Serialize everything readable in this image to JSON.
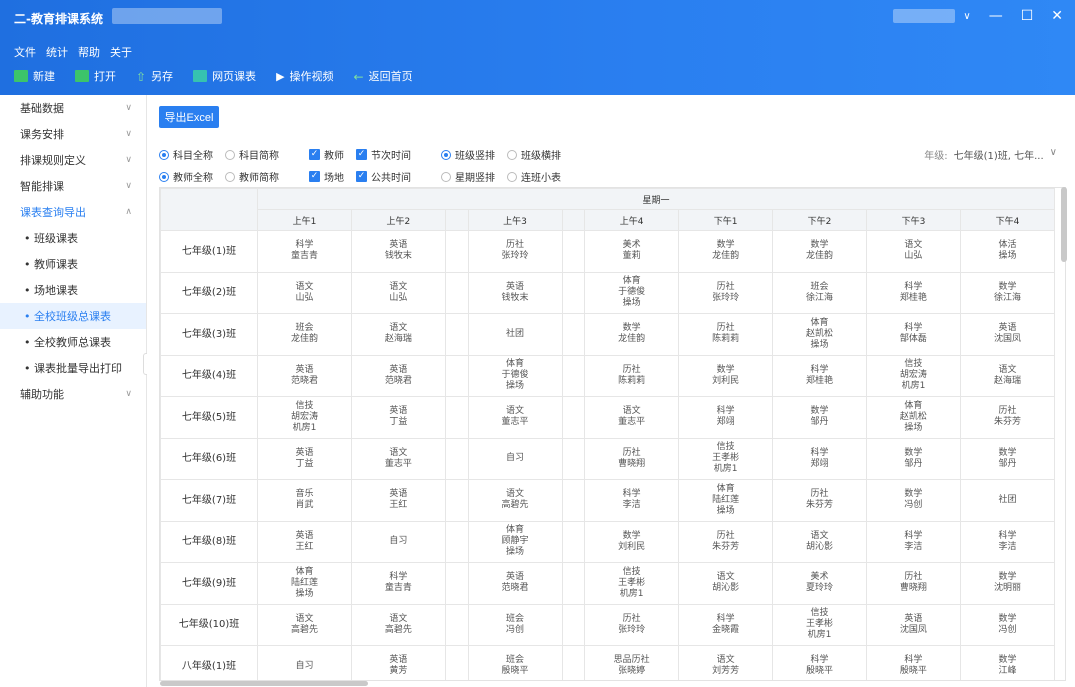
{
  "window": {
    "title": "二-教育排课系统"
  },
  "menu": [
    "文件",
    "统计",
    "帮助",
    "关于"
  ],
  "toolbar": [
    {
      "label": "新建",
      "icon": "new-file-icon"
    },
    {
      "label": "打开",
      "icon": "folder-icon"
    },
    {
      "label": "另存",
      "icon": "save-as-icon"
    },
    {
      "label": "网页课表",
      "icon": "web-table-icon"
    },
    {
      "label": "操作视频",
      "icon": "video-icon"
    },
    {
      "label": "返回首页",
      "icon": "back-arrow-icon"
    }
  ],
  "sidebar": {
    "items": [
      {
        "label": "基础数据",
        "chev": "∨"
      },
      {
        "label": "课务安排",
        "chev": "∨"
      },
      {
        "label": "排课规则定义",
        "chev": "∨"
      },
      {
        "label": "智能排课",
        "chev": "∨"
      },
      {
        "label": "课表查询导出",
        "chev": "∧"
      }
    ],
    "subitems": [
      "• 班级课表",
      "• 教师课表",
      "• 场地课表",
      "• 全校班级总课表",
      "• 全校教师总课表",
      "• 课表批量导出打印"
    ],
    "active_sub": 3,
    "last": {
      "label": "辅助功能",
      "chev": "∨"
    }
  },
  "export_label": "导出Excel",
  "options": {
    "row1": {
      "radios1": [
        {
          "label": "科目全称",
          "on": true
        },
        {
          "label": "科目简称",
          "on": false
        }
      ],
      "checks": [
        {
          "label": "教师",
          "on": true
        },
        {
          "label": "节次时间",
          "on": true
        }
      ],
      "radios2": [
        {
          "label": "班级竖排",
          "on": true
        },
        {
          "label": "班级横排",
          "on": false
        }
      ]
    },
    "row2": {
      "radios1": [
        {
          "label": "教师全称",
          "on": true
        },
        {
          "label": "教师简称",
          "on": false
        }
      ],
      "checks": [
        {
          "label": "场地",
          "on": true
        },
        {
          "label": "公共时间",
          "on": true
        }
      ],
      "radios2": [
        {
          "label": "星期竖排",
          "on": false
        },
        {
          "label": "连班小表",
          "on": false
        }
      ]
    }
  },
  "grade": {
    "label": "年级:",
    "value": "七年级(1)班, 七年..."
  },
  "table": {
    "day": "星期一",
    "periods": [
      "上午1",
      "上午2",
      "",
      "上午3",
      "",
      "上午4",
      "下午1",
      "下午2",
      "下午3",
      "下午4"
    ],
    "rows": [
      {
        "cls": "七年级(1)班",
        "cells": [
          "科学\n童吉青",
          "英语\n钱牧末",
          "",
          "历社\n张玲玲",
          "",
          "美术\n董莉",
          "数学\n龙佳韵",
          "数学\n龙佳韵",
          "语文\n山弘",
          "体活\n操场"
        ]
      },
      {
        "cls": "七年级(2)班",
        "cells": [
          "语文\n山弘",
          "语文\n山弘",
          "",
          "英语\n钱牧末",
          "",
          "体育\n于德俊\n操场",
          "历社\n张玲玲",
          "班会\n徐江海",
          "科学\n郑桂艳",
          "数学\n徐江海"
        ]
      },
      {
        "cls": "七年级(3)班",
        "cells": [
          "班会\n龙佳韵",
          "语文\n赵海瑞",
          "",
          "社团",
          "",
          "数学\n龙佳韵",
          "历社\n陈莉莉",
          "体育\n赵凯松\n操场",
          "科学\n郜体磊",
          "英语\n沈国凤"
        ]
      },
      {
        "cls": "七年级(4)班",
        "cells": [
          "英语\n范晓君",
          "英语\n范晓君",
          "",
          "体育\n于德俊\n操场",
          "",
          "历社\n陈莉莉",
          "数学\n刘利民",
          "科学\n郑桂艳",
          "信技\n胡宏涛\n机房1",
          "语文\n赵海瑞"
        ]
      },
      {
        "cls": "七年级(5)班",
        "cells": [
          "信技\n胡宏涛\n机房1",
          "英语\n丁益",
          "",
          "语文\n董志平",
          "",
          "语文\n董志平",
          "科学\n郑翊",
          "数学\n邹丹",
          "体育\n赵凯松\n操场",
          "历社\n朱芬芳"
        ]
      },
      {
        "cls": "七年级(6)班",
        "cells": [
          "英语\n丁益",
          "语文\n董志平",
          "",
          "自习",
          "",
          "历社\n曹晓翔",
          "信技\n王孝彬\n机房1",
          "科学\n郑翊",
          "数学\n邹丹",
          "数学\n邹丹"
        ]
      },
      {
        "cls": "七年级(7)班",
        "cells": [
          "音乐\n肖武",
          "英语\n王红",
          "",
          "语文\n高碧先",
          "",
          "科学\n李洁",
          "体育\n陆红莲\n操场",
          "历社\n朱芬芳",
          "数学\n冯创",
          "社团"
        ]
      },
      {
        "cls": "七年级(8)班",
        "cells": [
          "英语\n王红",
          "自习",
          "",
          "体育\n顾静宇\n操场",
          "",
          "数学\n刘利民",
          "历社\n朱芬芳",
          "语文\n胡沁影",
          "科学\n李洁",
          "科学\n李洁"
        ]
      },
      {
        "cls": "七年级(9)班",
        "cells": [
          "体育\n陆红莲\n操场",
          "科学\n童吉青",
          "",
          "英语\n范晓君",
          "",
          "信技\n王孝彬\n机房1",
          "语文\n胡沁影",
          "美术\n夏玲玲",
          "历社\n曹晓翔",
          "数学\n沈明丽"
        ]
      },
      {
        "cls": "七年级(10)班",
        "cells": [
          "语文\n高碧先",
          "语文\n高碧先",
          "",
          "班会\n冯创",
          "",
          "历社\n张玲玲",
          "科学\n金晓霞",
          "信技\n王孝彬\n机房1",
          "英语\n沈国凤",
          "数学\n冯创"
        ]
      },
      {
        "cls": "八年级(1)班",
        "cells": [
          "自习",
          "英语\n黄芳",
          "",
          "班会\n殷晓平",
          "",
          "思品历社\n张晓婷",
          "语文\n刘芳芳",
          "科学\n殷晓平",
          "科学\n殷晓平",
          "数学\n江峰"
        ]
      }
    ]
  }
}
